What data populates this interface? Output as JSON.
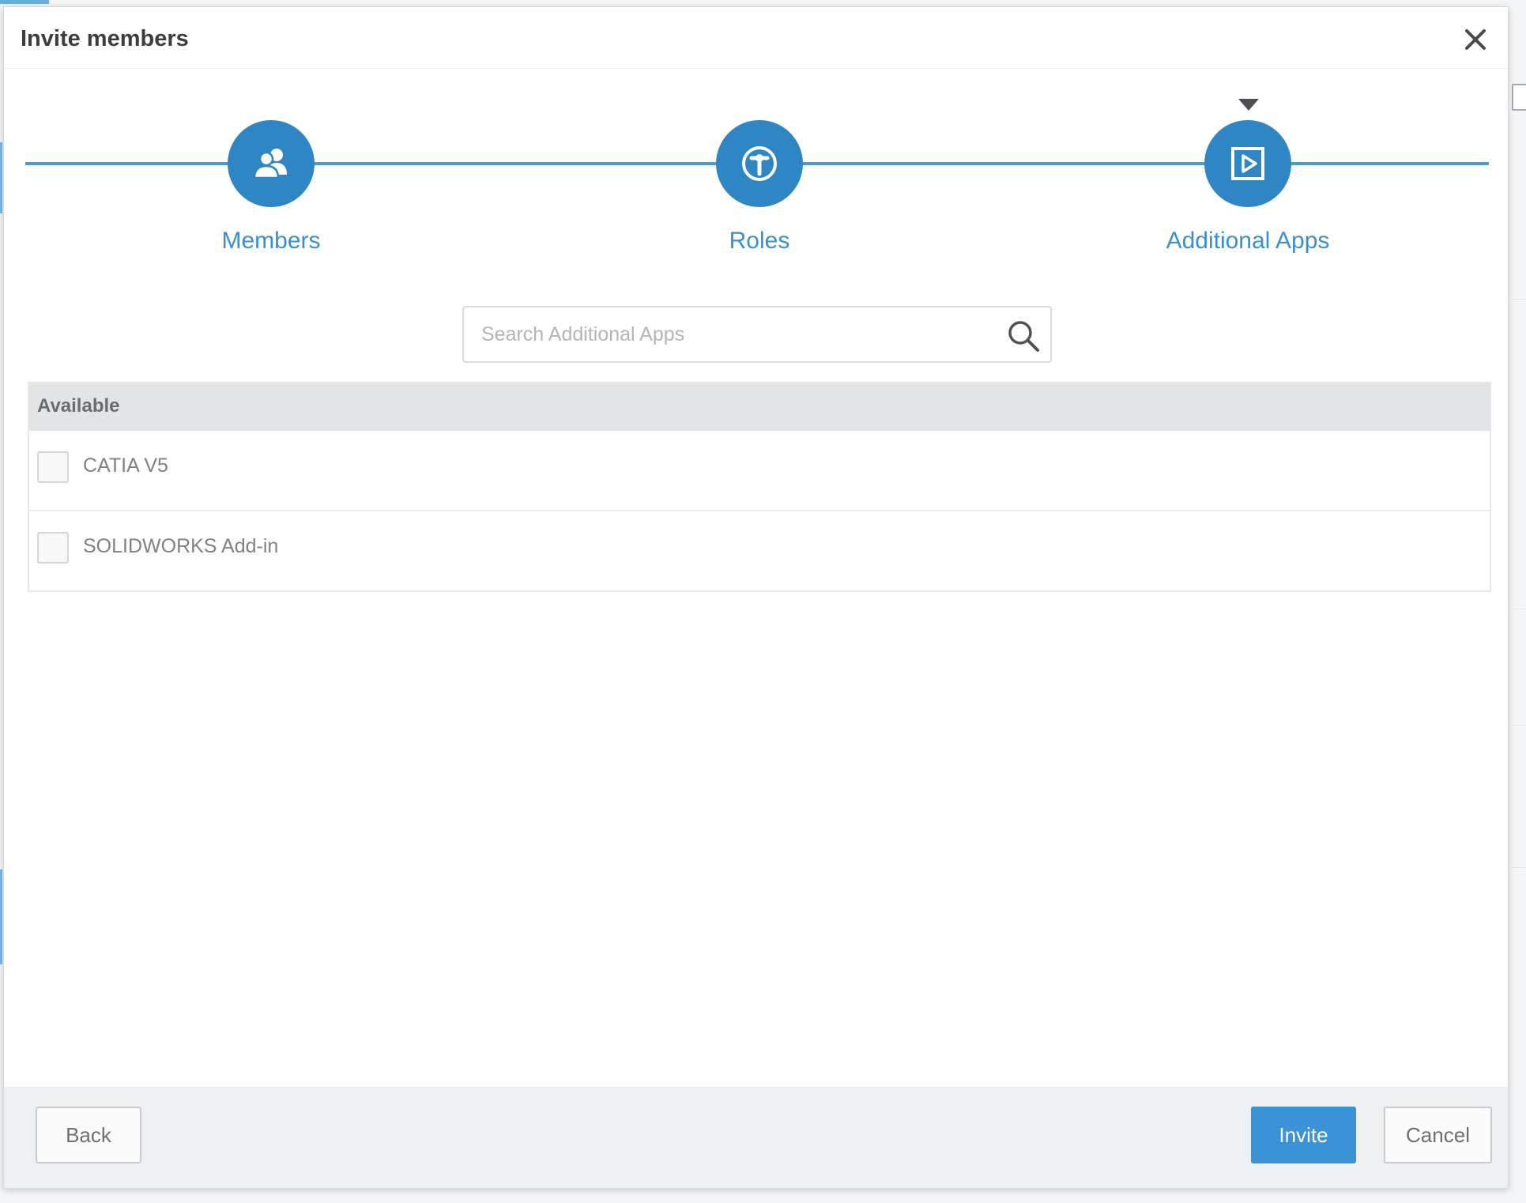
{
  "dialog": {
    "title": "Invite members",
    "close_icon": "close-icon"
  },
  "stepper": {
    "steps": [
      {
        "label": "Members",
        "icon": "users-icon"
      },
      {
        "label": "Roles",
        "icon": "role-key-icon"
      },
      {
        "label": "Additional Apps",
        "icon": "play-app-icon"
      }
    ],
    "active_step": "Additional Apps"
  },
  "search": {
    "placeholder": "Search Additional Apps",
    "value": "",
    "icon": "search-icon"
  },
  "apps": {
    "header": "Available",
    "items": [
      {
        "label": "CATIA V5",
        "checked": false
      },
      {
        "label": "SOLIDWORKS Add-in",
        "checked": false
      }
    ]
  },
  "footer": {
    "back_label": "Back",
    "invite_label": "Invite",
    "cancel_label": "Cancel"
  },
  "colors": {
    "accent": "#2f86c5",
    "step_label": "#3a8fd0",
    "primary_button": "#3a93d6"
  }
}
